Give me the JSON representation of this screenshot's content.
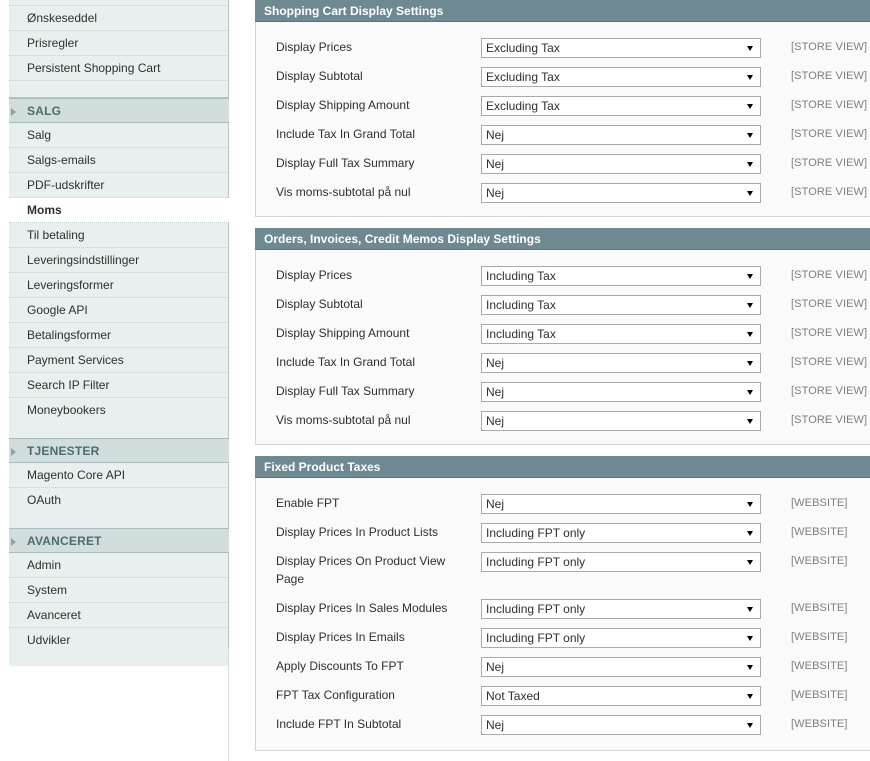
{
  "sidebar": {
    "top_items": [
      "Ønskeseddel",
      "Prisregler",
      "Persistent Shopping Cart"
    ],
    "groups": [
      {
        "title": "SALG",
        "items": [
          "Salg",
          "Salgs-emails",
          "PDF-udskrifter",
          "Moms",
          "Til betaling",
          "Leveringsindstillinger",
          "Leveringsformer",
          "Google API",
          "Betalingsformer",
          "Payment Services",
          "Search IP Filter",
          "Moneybookers"
        ],
        "active": "Moms"
      },
      {
        "title": "TJENESTER",
        "items": [
          "Magento Core API",
          "OAuth"
        ]
      },
      {
        "title": "AVANCERET",
        "items": [
          "Admin",
          "System",
          "Avanceret",
          "Udvikler"
        ]
      }
    ]
  },
  "sections": [
    {
      "title": "Shopping Cart Display Settings",
      "rows": [
        {
          "label": "Display Prices",
          "value": "Excluding Tax",
          "scope": "[STORE VIEW]"
        },
        {
          "label": "Display Subtotal",
          "value": "Excluding Tax",
          "scope": "[STORE VIEW]"
        },
        {
          "label": "Display Shipping Amount",
          "value": "Excluding Tax",
          "scope": "[STORE VIEW]"
        },
        {
          "label": "Include Tax In Grand Total",
          "value": "Nej",
          "scope": "[STORE VIEW]"
        },
        {
          "label": "Display Full Tax Summary",
          "value": "Nej",
          "scope": "[STORE VIEW]"
        },
        {
          "label": "Vis moms-subtotal på nul",
          "value": "Nej",
          "scope": "[STORE VIEW]"
        }
      ]
    },
    {
      "title": "Orders, Invoices, Credit Memos Display Settings",
      "rows": [
        {
          "label": "Display Prices",
          "value": "Including Tax",
          "scope": "[STORE VIEW]"
        },
        {
          "label": "Display Subtotal",
          "value": "Including Tax",
          "scope": "[STORE VIEW]"
        },
        {
          "label": "Display Shipping Amount",
          "value": "Including Tax",
          "scope": "[STORE VIEW]"
        },
        {
          "label": "Include Tax In Grand Total",
          "value": "Nej",
          "scope": "[STORE VIEW]"
        },
        {
          "label": "Display Full Tax Summary",
          "value": "Nej",
          "scope": "[STORE VIEW]"
        },
        {
          "label": "Vis moms-subtotal på nul",
          "value": "Nej",
          "scope": "[STORE VIEW]"
        }
      ]
    },
    {
      "title": "Fixed Product Taxes",
      "rows": [
        {
          "label": "Enable FPT",
          "value": "Nej",
          "scope": "[WEBSITE]"
        },
        {
          "label": "Display Prices In Product Lists",
          "value": "Including FPT only",
          "scope": "[WEBSITE]"
        },
        {
          "label": "Display Prices On Product View Page",
          "value": "Including FPT only",
          "scope": "[WEBSITE]"
        },
        {
          "label": "Display Prices In Sales Modules",
          "value": "Including FPT only",
          "scope": "[WEBSITE]"
        },
        {
          "label": "Display Prices In Emails",
          "value": "Including FPT only",
          "scope": "[WEBSITE]"
        },
        {
          "label": "Apply Discounts To FPT",
          "value": "Nej",
          "scope": "[WEBSITE]"
        },
        {
          "label": "FPT Tax Configuration",
          "value": "Not Taxed",
          "scope": "[WEBSITE]"
        },
        {
          "label": "Include FPT In Subtotal",
          "value": "Nej",
          "scope": "[WEBSITE]"
        }
      ]
    }
  ]
}
